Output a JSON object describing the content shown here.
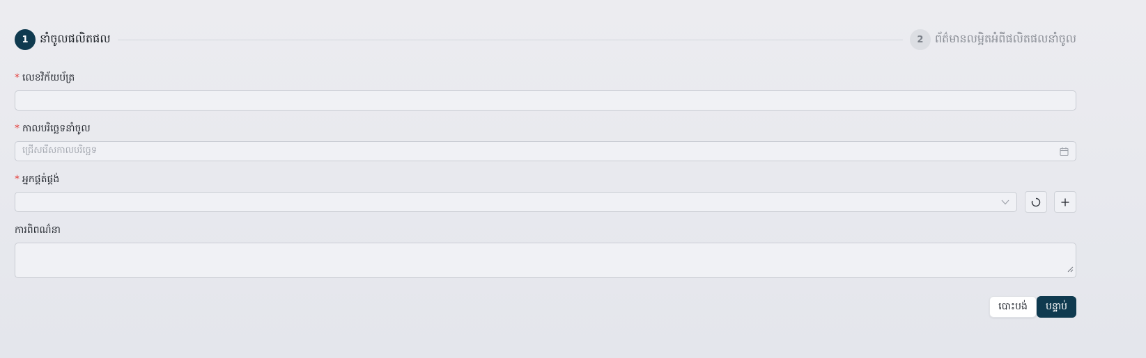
{
  "stepper": {
    "steps": [
      {
        "number": "1",
        "label": "នាំចូលផលិតផល",
        "state": "active"
      },
      {
        "number": "2",
        "label": "ព័ត៌មានលម្អិតអំពីផលិតផលនាំចូល",
        "state": "inactive"
      }
    ]
  },
  "form": {
    "invoice": {
      "label": "លេខវិក័យប័ត្រ",
      "required_mark": "*",
      "value": "",
      "placeholder": ""
    },
    "import_date": {
      "label": "កាលបរិច្ឆេទនាំចូល",
      "required_mark": "*",
      "placeholder": "ជ្រើសរើសកាលបរិច្ឆេទ",
      "icon": "calendar-icon"
    },
    "supplier": {
      "label": "អ្នកផ្គត់ផ្គង់",
      "required_mark": "*",
      "value": "",
      "icon": "chevron-down-icon",
      "reload_icon": "reload-icon",
      "add_icon": "plus-icon"
    },
    "description": {
      "label": "ការពិពណ៌នា",
      "value": "",
      "icon": "resize-handle-icon"
    }
  },
  "actions": {
    "cancel_label": "បោះបង់",
    "submit_label": "បន្ទាប់"
  },
  "colors": {
    "primary": "#0f3a4f",
    "required": "#e53935",
    "background": "#e8e9ee"
  }
}
